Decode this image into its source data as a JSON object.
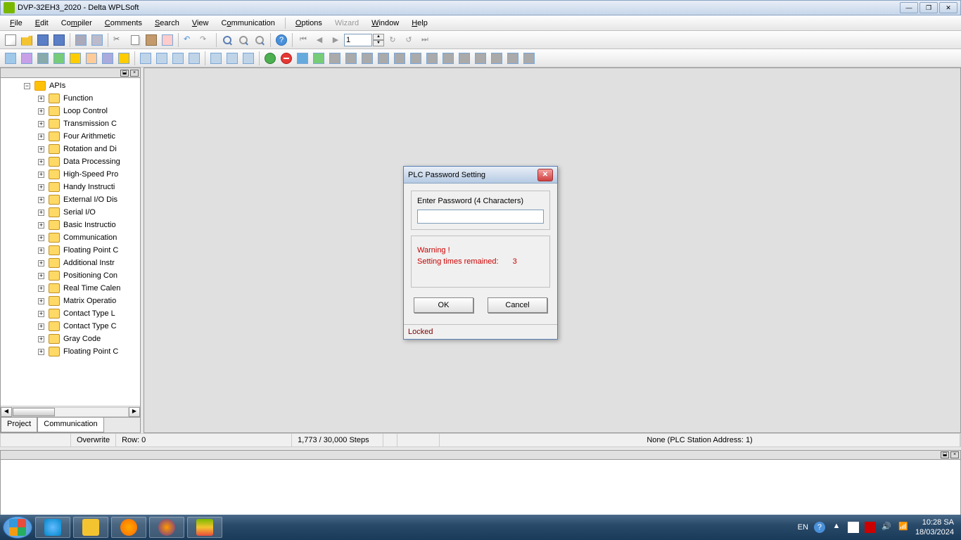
{
  "titlebar": {
    "title": "DVP-32EH3_2020 - Delta WPLSoft"
  },
  "menu": {
    "file": "File",
    "edit": "Edit",
    "compiler": "Compiler",
    "comments": "Comments",
    "search": "Search",
    "view": "View",
    "communication": "Communication",
    "options": "Options",
    "wizard": "Wizard",
    "window": "Window",
    "help": "Help"
  },
  "toolbar": {
    "page_input": "1"
  },
  "tree": {
    "root": "APIs",
    "items": [
      "Function",
      "Loop Control",
      "Transmission C",
      "Four Arithmetic",
      "Rotation and Di",
      "Data Processing",
      "High-Speed Pro",
      "Handy Instructi",
      "External I/O Dis",
      "Serial I/O",
      "Basic Instructio",
      "Communication",
      "Floating Point C",
      "Additional Instr",
      "Positioning Con",
      "Real Time Calen",
      "Matrix Operatio",
      "Contact Type L",
      "Contact Type C",
      "Gray Code",
      "Floating Point C"
    ]
  },
  "sidebar_tabs": {
    "project": "Project",
    "communication": "Communication"
  },
  "statusbar": {
    "mode": "Overwrite",
    "row": "Row: 0",
    "steps": "1,773 / 30,000 Steps",
    "station": "None (PLC Station Address: 1)"
  },
  "dialog": {
    "title": "PLC Password Setting",
    "enter_label": "Enter Password (4 Characters)",
    "warning": "Warning !",
    "remained_label": "Setting times remained:",
    "remained_count": "3",
    "ok": "OK",
    "cancel": "Cancel",
    "status": "Locked"
  },
  "tray": {
    "lang": "EN",
    "time": "10:28 SA",
    "date": "18/03/2024"
  }
}
